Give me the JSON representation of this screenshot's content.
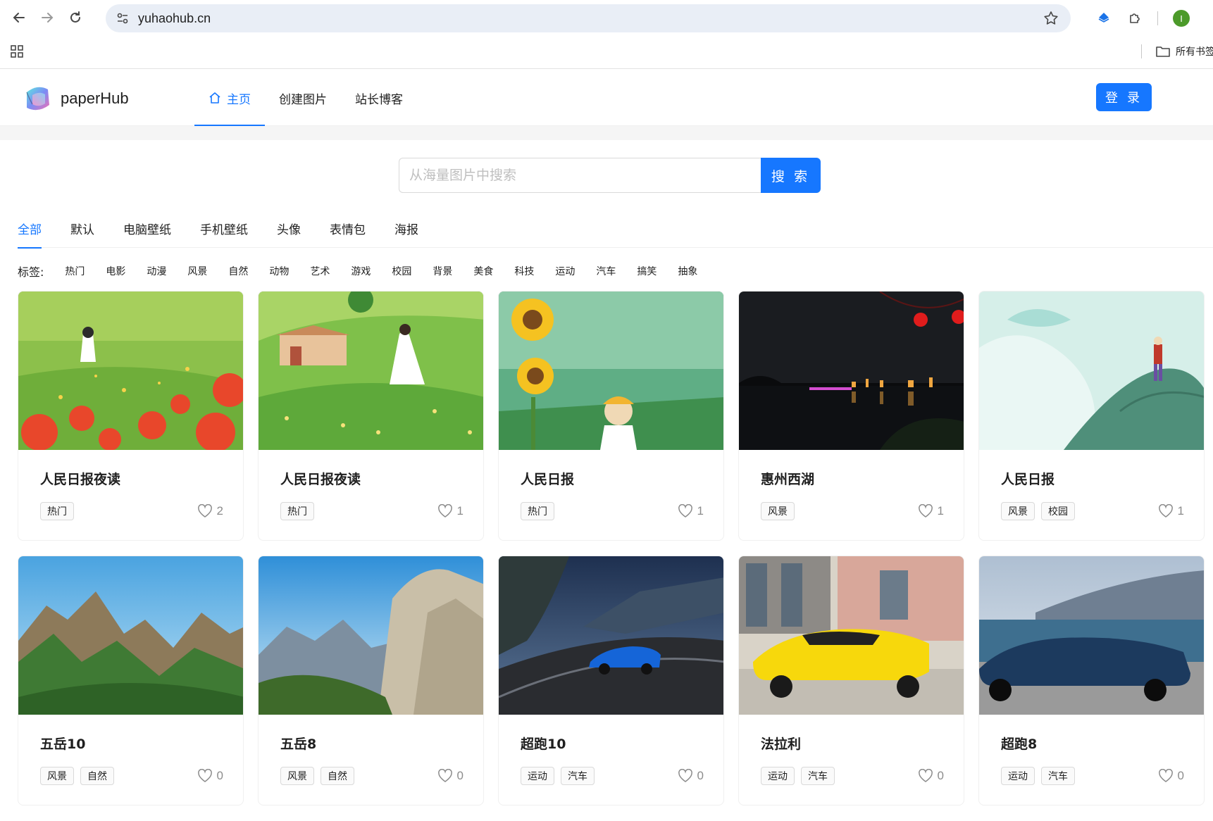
{
  "browser": {
    "url": "yuhaohub.cn",
    "bookmark_folder": "所有书签"
  },
  "site": {
    "logo_text": "paperHub",
    "nav": [
      {
        "label": "主页",
        "active": true
      },
      {
        "label": "创建图片",
        "active": false
      },
      {
        "label": "站长博客",
        "active": false
      }
    ],
    "login_label": "登 录",
    "accent_color": "#1677ff"
  },
  "search": {
    "placeholder": "从海量图片中搜索",
    "button_label": "搜 索"
  },
  "categories": [
    "全部",
    "默认",
    "电脑壁纸",
    "手机壁纸",
    "头像",
    "表情包",
    "海报"
  ],
  "tags": {
    "label": "标签:",
    "items": [
      "热门",
      "电影",
      "动漫",
      "风景",
      "自然",
      "动物",
      "艺术",
      "游戏",
      "校园",
      "背景",
      "美食",
      "科技",
      "运动",
      "汽车",
      "搞笑",
      "抽象"
    ]
  },
  "cards": [
    {
      "title": "人民日报夜读",
      "tags": [
        "热门"
      ],
      "likes": "2",
      "image": "flower-field-girl"
    },
    {
      "title": "人民日报夜读",
      "tags": [
        "热门"
      ],
      "likes": "1",
      "image": "hill-girl-white-dress"
    },
    {
      "title": "人民日报",
      "tags": [
        "热门"
      ],
      "likes": "1",
      "image": "sunflowers-girl"
    },
    {
      "title": "惠州西湖",
      "tags": [
        "风景"
      ],
      "likes": "1",
      "image": "night-lake"
    },
    {
      "title": "人民日报",
      "tags": [
        "风景",
        "校园"
      ],
      "likes": "1",
      "image": "hiker-cliff"
    },
    {
      "title": "五岳10",
      "tags": [
        "风景",
        "自然"
      ],
      "likes": "0",
      "image": "green-mountains"
    },
    {
      "title": "五岳8",
      "tags": [
        "风景",
        "自然"
      ],
      "likes": "0",
      "image": "rocky-cliff"
    },
    {
      "title": "超跑10",
      "tags": [
        "运动",
        "汽车"
      ],
      "likes": "0",
      "image": "blue-supercar"
    },
    {
      "title": "法拉利",
      "tags": [
        "运动",
        "汽车"
      ],
      "likes": "0",
      "image": "yellow-ferrari"
    },
    {
      "title": "超跑8",
      "tags": [
        "运动",
        "汽车"
      ],
      "likes": "0",
      "image": "blue-convertible"
    }
  ]
}
